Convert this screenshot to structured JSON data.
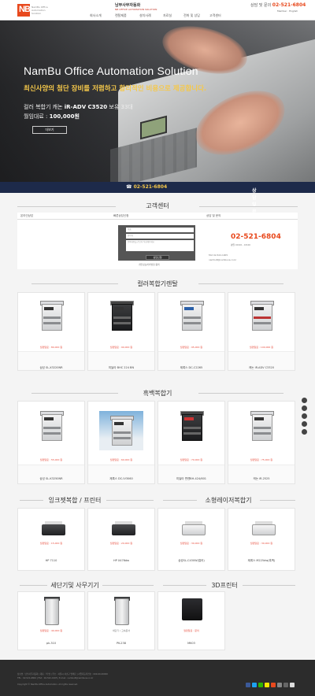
{
  "header": {
    "logo_text": "NB",
    "logo_sub": "NamBu Office Automation Solution",
    "brand": "남부사무자동화",
    "brand_sub": "NB OFFICE AUTOMATION SOLUTION",
    "phone_label": "상담 및 문의",
    "phone": "02-521-6804",
    "lang": "Member · English",
    "nav": [
      "회사소개",
      "렌탈제품",
      "설치사례",
      "자료실",
      "전화 및 상담",
      "고객센터"
    ]
  },
  "hero": {
    "title": "NamBu Office Automation Solution",
    "subtitle": "최신사양의 첨단 장비를 저렴하고 합리적인 비용으로 제공합니다.",
    "line1_prefix": "컬러 복합기 캐논",
    "line1_model": "iR-ADV C3520",
    "line1_suffix": "보유 33대",
    "line2_prefix": "월임대료 :",
    "line2_price": "100,000원",
    "button": "더보기",
    "bar_label": "상담 및 문의",
    "bar_phone": "02-521-6804"
  },
  "customer": {
    "title": "고객센터",
    "left_label": "온라인상담",
    "mid_label": "빠른상담신청",
    "right_label": "상담 및 문의",
    "fields": [
      "이름",
      "연락처",
      "문의내용을 간단히 작성해주세요"
    ],
    "submit": "상담신청",
    "privacy": "개인정보처리방침 동의",
    "phone": "02-521-6804",
    "hours": "평일 09:00 - 18:00",
    "fax": "FAX 02-522-1905",
    "email": "nambu8@nambuoa.co.kr"
  },
  "sections": {
    "color": "컬러복합기렌탈",
    "mono": "흑백복합기",
    "ink": "잉크젯복합 / 프린터",
    "small": "소형레이저복합기",
    "shred": "세단기및 사무기기",
    "printer3d": "3D프린터"
  },
  "color_products": [
    {
      "badge": "월렌탈료 : 80,000 원",
      "name": "삼성 SL-X3220NR"
    },
    {
      "badge": "월렌탈료 : 90,000 원",
      "name": "미놀타 BHC 224 BN"
    },
    {
      "badge": "월렌탈료 : 95,000 원",
      "name": "제록스 DC-C2265"
    },
    {
      "badge": "월렌탈료 : 100,000 원",
      "name": "캐논 iR-ADV C3320"
    }
  ],
  "mono_products": [
    {
      "badge": "월렌탈료 : 55,000 원",
      "name": "삼성 SL-K3250NR"
    },
    {
      "badge": "월렌탈료 : 60,000 원",
      "name": "제록스 DC-IV3060"
    },
    {
      "badge": "월렌탈료 : 70,000 원",
      "name": "미놀타 변켄BH-424/601"
    },
    {
      "badge": "월렌탈료 : 75,000 원",
      "name": "캐논 iR-2525"
    }
  ],
  "ink_products": [
    {
      "badge": "월렌탈료 : 15,000 원",
      "name": "HP 7110"
    },
    {
      "badge": "월렌탈료 : 20,000 원",
      "name": "HP X476dw"
    }
  ],
  "small_products": [
    {
      "badge": "월렌탈료 : 30,000 원",
      "name": "삼성SL-C430W(컬러)"
    },
    {
      "badge": "월렌탈료 : 30,000 원",
      "name": "제록스 M225dw(흑백)"
    }
  ],
  "shred_products": [
    {
      "badge": "월렌탈료 : 40,000 원",
      "name": "pk-310"
    },
    {
      "badge": "세단기 / 고속문서",
      "name": "PK-238"
    }
  ],
  "printer3d_products": [
    {
      "badge": "월렌탈료 : 문의",
      "name": "MK03"
    }
  ],
  "footer": {
    "line1": "상호명 : 남부사무자동화 | 대표 : 박 명 | 주소 : 서울시 서초구 방배로 | 사업자등록번호 : 000-00-00000",
    "line2": "TEL : 02-521-6804 | FAX : 02-522-1905 | E-mail : nambu8@nambuoa.co.kr",
    "line3": "Copyright © NamBu Office Automation. All rights reserved."
  },
  "colors": {
    "accent": "#e8491d",
    "navy": "#1d2a4a",
    "price": "#e74c3c"
  }
}
